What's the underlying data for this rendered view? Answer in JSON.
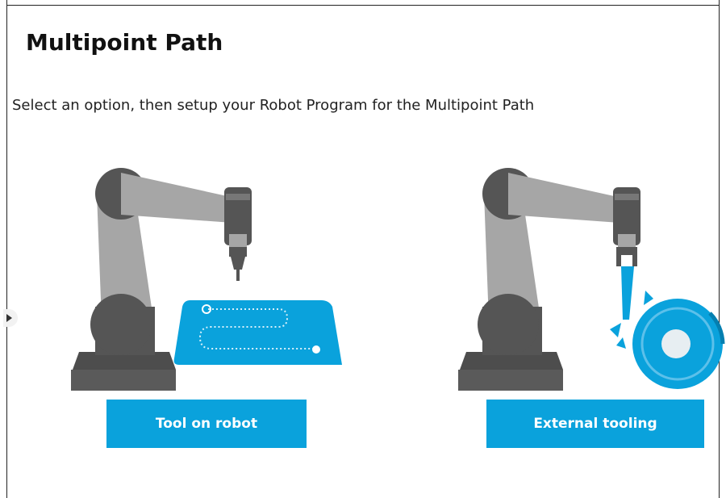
{
  "header": {
    "title": "Multipoint Path",
    "instructions": "Select an option, then setup your Robot Program for the Multipoint Path"
  },
  "options": [
    {
      "label": "Tool on robot",
      "illustration": "robot-with-tool-icon"
    },
    {
      "label": "External tooling",
      "illustration": "robot-with-external-tool-icon"
    }
  ],
  "colors": {
    "accent": "#0aa2dc",
    "robot_dark": "#555555",
    "robot_light": "#a6a6a6"
  }
}
